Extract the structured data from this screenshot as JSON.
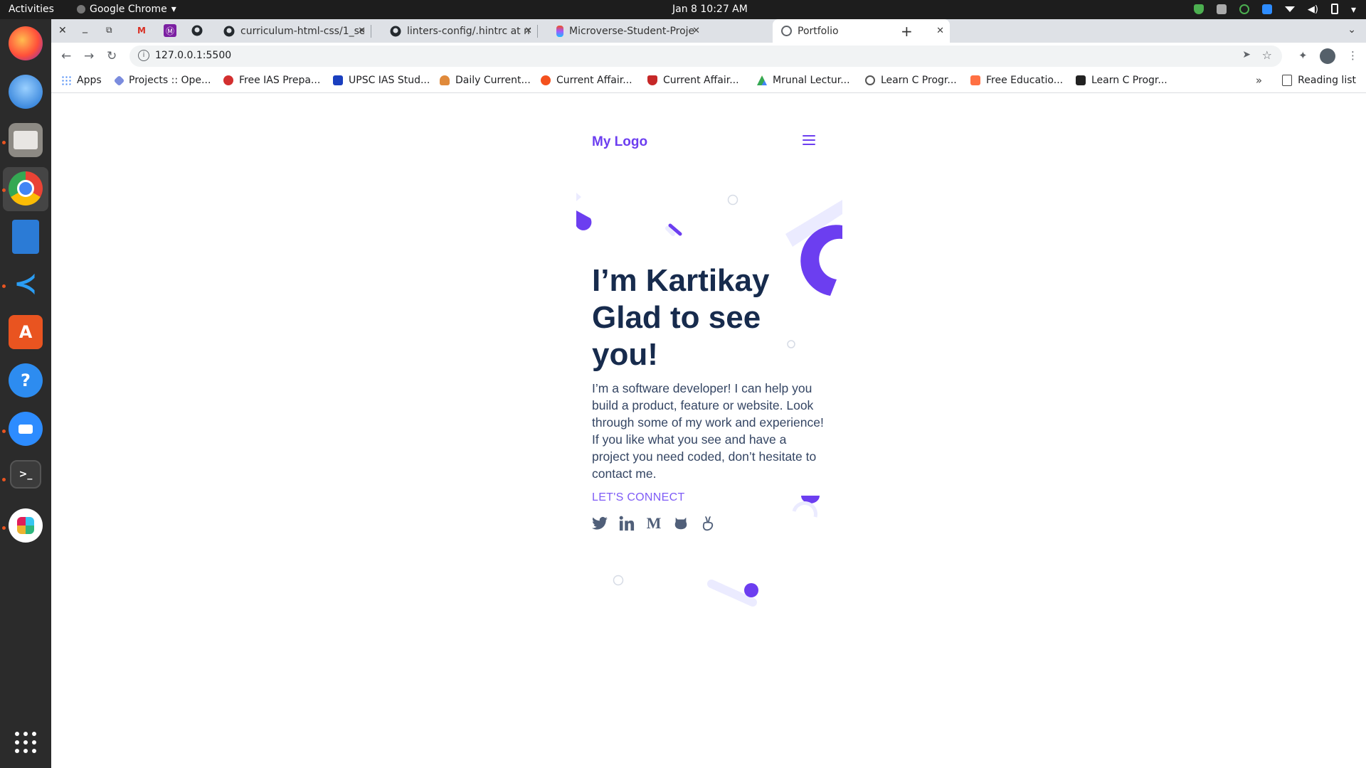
{
  "system": {
    "activities": "Activities",
    "app_name": "Google Chrome",
    "clock": "Jan 8  10:27 AM"
  },
  "browser": {
    "tabs": [
      {
        "title": "curriculum-html-css/1_se",
        "icon": "github-icon"
      },
      {
        "title": "linters-config/.hintrc at m",
        "icon": "github-icon"
      },
      {
        "title": "Microverse-Student-Proje",
        "icon": "figma-icon"
      },
      {
        "title": "Portfolio",
        "icon": "globe-icon"
      }
    ],
    "address": "127.0.0.1:5500",
    "bookmarks": [
      {
        "label": "Apps",
        "icon": "apps-grid-icon",
        "color": "#4285f4"
      },
      {
        "label": "Projects :: Ope...",
        "icon": "projects-icon",
        "color": "#7b8cde"
      },
      {
        "label": "Free IAS Prepa...",
        "icon": "ias-icon",
        "color": "#d32f2f"
      },
      {
        "label": "UPSC IAS Stud...",
        "icon": "upsc-icon",
        "color": "#1a3fbf"
      },
      {
        "label": "Daily Current...",
        "icon": "daily-current-icon",
        "color": "#e08a3b"
      },
      {
        "label": "Current Affair...",
        "icon": "current-affairs-icon",
        "color": "#f4511e"
      },
      {
        "label": "Current Affair...",
        "icon": "current-affairs-shield-icon",
        "color": "#c62828"
      },
      {
        "label": "Mrunal Lectur...",
        "icon": "google-drive-icon",
        "color": "#34a853"
      },
      {
        "label": "Learn C Progr...",
        "icon": "globe-icon",
        "color": "#555555"
      },
      {
        "label": "Free Educatio...",
        "icon": "free-education-icon",
        "color": "#ff7043"
      },
      {
        "label": "Learn C Progr...",
        "icon": "learn-c-icon",
        "color": "#222222"
      }
    ],
    "reading_list": "Reading list"
  },
  "page": {
    "logo": "My Logo",
    "headline_line1": "I’m Kartikay",
    "headline_line2": "Glad to see",
    "headline_line3": "you!",
    "intro": "I’m a software developer! I can help you build a product, feature or website. Look through some of my work and experience! If you like what you see and have a project you need coded, don’t hesitate to contact me.",
    "connect": "LET'S CONNECT",
    "socials": [
      "twitter-icon",
      "linkedin-icon",
      "medium-icon",
      "github-icon",
      "angellist-icon"
    ]
  },
  "colors": {
    "accent": "#6c3ef0",
    "accent_light": "#ebebff",
    "heading": "#172b4d",
    "text": "#344563"
  }
}
